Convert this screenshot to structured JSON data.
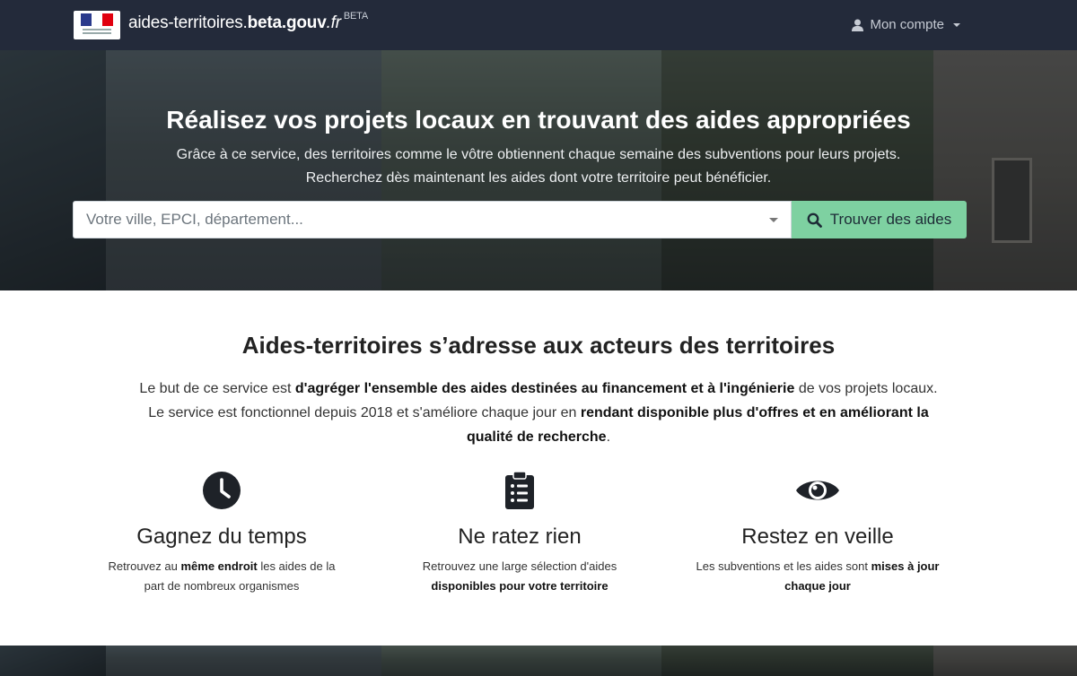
{
  "navbar": {
    "brand_prefix": "aides-territoires.",
    "brand_bold": "beta.gouv",
    "brand_suffix": ".fr",
    "brand_badge": "BETA",
    "account_label": "Mon compte"
  },
  "hero": {
    "title": "Réalisez vos projets locaux en trouvant des aides appropriées",
    "subtitle_line1": "Grâce à ce service, des territoires comme le vôtre obtiennent chaque semaine des subventions pour leurs projets.",
    "subtitle_line2": "Recherchez dès maintenant les aides dont votre territoire peut bénéficier.",
    "search_placeholder": "Votre ville, EPCI, département...",
    "search_button": "Trouver des aides"
  },
  "about": {
    "title": "Aides-territoires s’adresse aux acteurs des territoires",
    "p1_start": "Le but de ce service est ",
    "p1_bold": "d'agréger l'ensemble des aides destinées au financement et à l'ingénierie",
    "p1_end": " de vos projets locaux.",
    "p2_start": "Le service est fonctionnel depuis 2018 et s'améliore chaque jour en ",
    "p2_bold": "rendant disponible plus d'offres et en améliorant la",
    "p3_bold": "qualité de recherche",
    "p3_end": "."
  },
  "features": [
    {
      "icon": "clock-icon",
      "title": "Gagnez du temps",
      "d1": "Retrouvez au ",
      "d1_bold": "même endroit",
      "d1_end": " les aides de la",
      "d2": "part de nombreux organismes"
    },
    {
      "icon": "clipboard-list-icon",
      "title": "Ne ratez rien",
      "d1": "Retrouvez une large sélection d'aides",
      "d2_bold": "disponibles pour votre territoire"
    },
    {
      "icon": "eye-icon",
      "title": "Restez en veille",
      "d1": "Les subventions et les aides sont ",
      "d1_bold": "mises à jour",
      "d2_bold": "chaque jour"
    }
  ]
}
